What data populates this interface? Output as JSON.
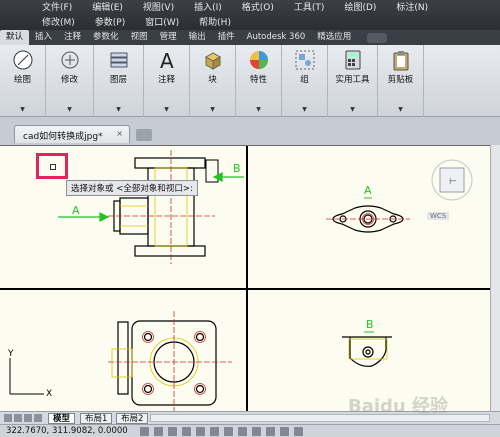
{
  "menu": {
    "row1": [
      "文件(F)",
      "编辑(E)",
      "视图(V)",
      "插入(I)",
      "格式(O)",
      "工具(T)",
      "绘图(D)",
      "标注(N)"
    ],
    "row2": [
      "修改(M)",
      "参数(P)",
      "窗口(W)",
      "帮助(H)"
    ]
  },
  "ribbon_tabs": [
    "默认",
    "插入",
    "注释",
    "参数化",
    "视图",
    "管理",
    "输出",
    "插件",
    "Autodesk 360",
    "精选应用"
  ],
  "active_ribbon_tab": "默认",
  "panels": [
    {
      "label": "绘图",
      "icon": "draw-icon"
    },
    {
      "label": "修改",
      "icon": "modify-icon"
    },
    {
      "label": "图层",
      "icon": "layers-icon"
    },
    {
      "label": "注释",
      "icon": "annotation-icon"
    },
    {
      "label": "块",
      "icon": "block-icon"
    },
    {
      "label": "特性",
      "icon": "properties-icon"
    },
    {
      "label": "组",
      "icon": "group-icon"
    },
    {
      "label": "实用工具",
      "icon": "utilities-icon"
    },
    {
      "label": "剪贴板",
      "icon": "clipboard-icon"
    }
  ],
  "file_tab": {
    "name": "cad如何转换成jpg*",
    "close": "×"
  },
  "drawing": {
    "prompt": "选择对象或 <全部对象和视口>:",
    "label_a": "A",
    "label_b": "B",
    "wcs": "WCS"
  },
  "layout_tabs": [
    "模型",
    "布局1",
    "布局2"
  ],
  "active_layout": "模型",
  "status": {
    "coords": "322.7670, 311.9082, 0.0000"
  },
  "watermark": "Baidu 经验",
  "colors": {
    "highlight": "#e0245e",
    "drawing_bg": "#fcfdf0",
    "ribbon_bg": "#2b2e33"
  }
}
